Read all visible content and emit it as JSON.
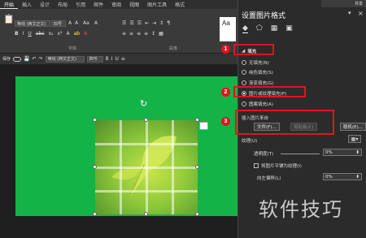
{
  "ribbon": {
    "tabs": [
      "开始",
      "插入",
      "设计",
      "布局",
      "引用",
      "邮件",
      "审阅",
      "视图",
      "图片工具",
      "格式"
    ],
    "font_name": "等线 (西文正文)",
    "font_size": "四号",
    "group_font": "字体",
    "group_paragraph": "段落",
    "row2_label": "保存",
    "row2_font": "等线 (西文正文)",
    "row2_size": "四号"
  },
  "pane": {
    "title": "设置图片格式",
    "close": "×",
    "dropdown": "▾",
    "section_fill": "填充",
    "options": [
      "无填充(N)",
      "纯色填充(S)",
      "渐变填充(G)",
      "图片或纹理填充(P)",
      "图案填充(A)"
    ],
    "selected_option_index": 3,
    "insert_from": "插入图片来自",
    "file_button": "文件(F)...",
    "clipboard_button": "剪贴板(C)",
    "online_button": "联机(E)...",
    "texture_label": "纹理(U)",
    "transparency_label": "透明度(T)",
    "transparency_value": "0%",
    "tile_label": "将图片平铺为纹理(I)",
    "offset_left_label": "向左偏移(L)",
    "offset_left_value": "0%",
    "share": "共享"
  },
  "badges": [
    "1",
    "2",
    "3"
  ],
  "watermark": "软件技巧"
}
